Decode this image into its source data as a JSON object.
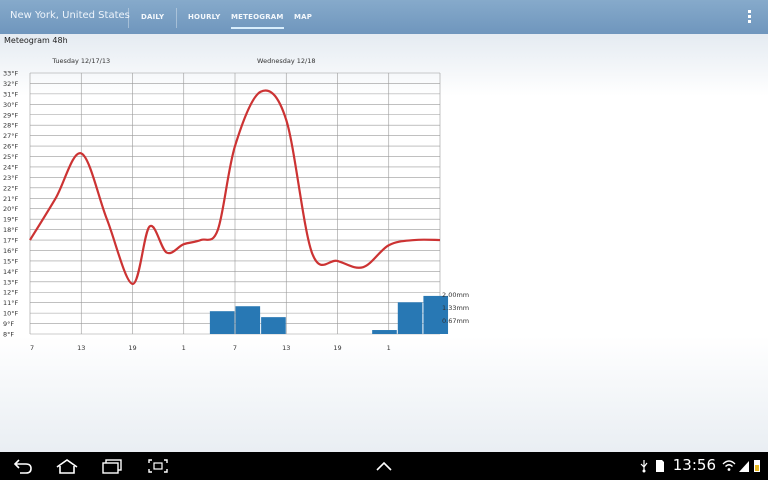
{
  "app": {
    "location": "New York, United States",
    "tabs": [
      {
        "label": "DAILY",
        "active": false
      },
      {
        "label": "HOURLY",
        "active": false
      },
      {
        "label": "METEOGRAM",
        "active": true
      },
      {
        "label": "MAP",
        "active": false
      }
    ],
    "accent_color": "#d9eefc",
    "header_color": "#7a9fc4"
  },
  "page": {
    "subtitle": "Meteogram 48h"
  },
  "chart_data": {
    "type": "line",
    "title": "",
    "day_labels": [
      {
        "label": "Tuesday 12/17/13",
        "at_hour_index": 6
      },
      {
        "label": "Wednesday 12/18",
        "at_hour_index": 30
      }
    ],
    "x_tick_labels": [
      "7",
      "13",
      "19",
      "1",
      "7",
      "13",
      "19",
      "1"
    ],
    "ylim": [
      8,
      33
    ],
    "y_unit": "°F",
    "y_tick_labels": [
      "33°F",
      "32°F",
      "31°F",
      "30°F",
      "29°F",
      "28°F",
      "27°F",
      "26°F",
      "25°F",
      "24°F",
      "23°F",
      "22°F",
      "21°F",
      "20°F",
      "19°F",
      "18°F",
      "17°F",
      "16°F",
      "15°F",
      "14°F",
      "13°F",
      "12°F",
      "11°F",
      "10°F",
      "9°F",
      "8°F"
    ],
    "series": [
      {
        "name": "",
        "color": "#cc3333",
        "x": [
          7,
          10,
          13,
          16,
          19,
          21,
          23,
          25,
          27,
          29,
          31,
          34,
          37,
          40,
          43,
          46,
          49,
          52,
          55
        ],
        "y": [
          17,
          21,
          25.3,
          19,
          12.8,
          18.3,
          15.8,
          16.6,
          17,
          18,
          26,
          31.2,
          28.5,
          15.8,
          15,
          14.4,
          16.5,
          17,
          17
        ]
      }
    ],
    "precip": {
      "unit": "mm",
      "color": "#2878b4",
      "axis_labels": [
        "2.00mm",
        "1.33mm",
        "0.67mm"
      ],
      "ymax": 2.0,
      "bars": [
        {
          "start": 28,
          "end": 31,
          "value": 1.15
        },
        {
          "start": 31,
          "end": 34,
          "value": 1.4
        },
        {
          "start": 34,
          "end": 37,
          "value": 0.85
        },
        {
          "start": 47,
          "end": 50,
          "value": 0.2
        },
        {
          "start": 50,
          "end": 53,
          "value": 1.6
        },
        {
          "start": 53,
          "end": 56,
          "value": 1.92
        }
      ]
    },
    "grid": true
  },
  "status_bar": {
    "time": "13:56"
  }
}
